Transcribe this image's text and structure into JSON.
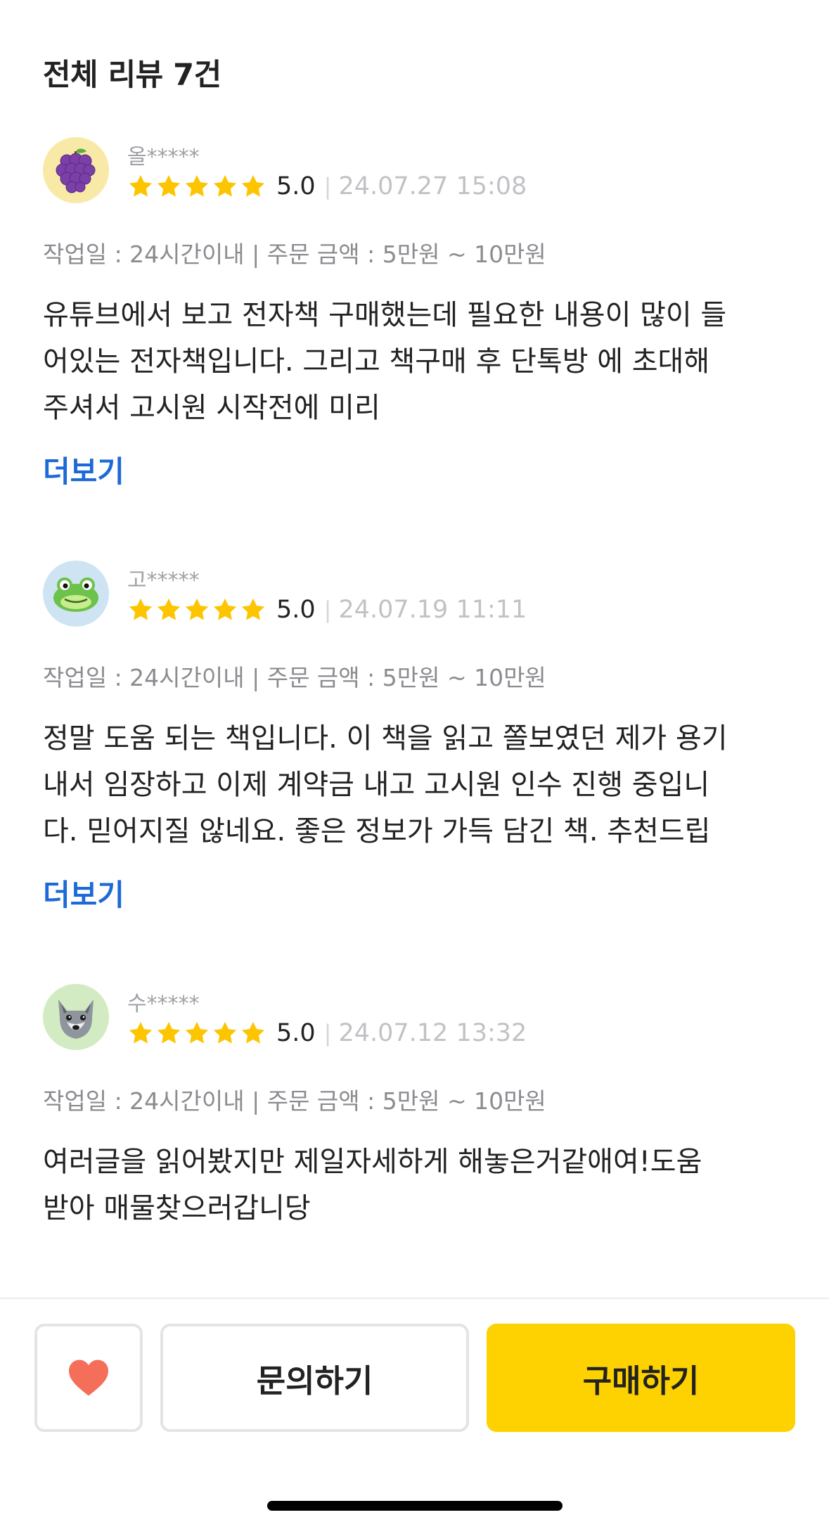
{
  "header": {
    "title": "전체 리뷰 7건"
  },
  "reviews": [
    {
      "avatar_icon": "grape-icon",
      "name": "올*****",
      "score": "5.0",
      "date": "24.07.27 15:08",
      "meta": "작업일 : 24시간이내 | 주문 금액 : 5만원 ~ 10만원",
      "body": "유튜브에서 보고 전자책 구매했는데 필요한 내용이 많이 들\n어있는 전자책입니다. 그리고 책구매 후 단톡방 에 초대해\n주셔서 고시원 시작전에 미리",
      "more": "더보기"
    },
    {
      "avatar_icon": "frog-icon",
      "name": "고*****",
      "score": "5.0",
      "date": "24.07.19 11:11",
      "meta": "작업일 : 24시간이내 | 주문 금액 : 5만원 ~ 10만원",
      "body": "정말 도움 되는 책입니다. 이 책을 읽고 쫄보였던 제가 용기\n내서 임장하고 이제 계약금 내고 고시원 인수 진행 중입니\n다. 믿어지질 않네요. 좋은 정보가 가득 담긴 책. 추천드립",
      "more": "더보기"
    },
    {
      "avatar_icon": "wolf-icon",
      "name": "수*****",
      "score": "5.0",
      "date": "24.07.12 13:32",
      "meta": "작업일 : 24시간이내 | 주문 금액 : 5만원 ~ 10만원",
      "body": "여러글을 읽어봤지만 제일자세하게 해놓은거같애여!도움\n받아 매물찾으러갑니당"
    }
  ],
  "bottom_bar": {
    "like_icon": "heart-icon",
    "inquiry_label": "문의하기",
    "buy_label": "구매하기"
  },
  "colors": {
    "star": "#fdc500",
    "more_link": "#1d6ad6",
    "buy_button": "#fdd200",
    "heart": "#f56e5a"
  }
}
